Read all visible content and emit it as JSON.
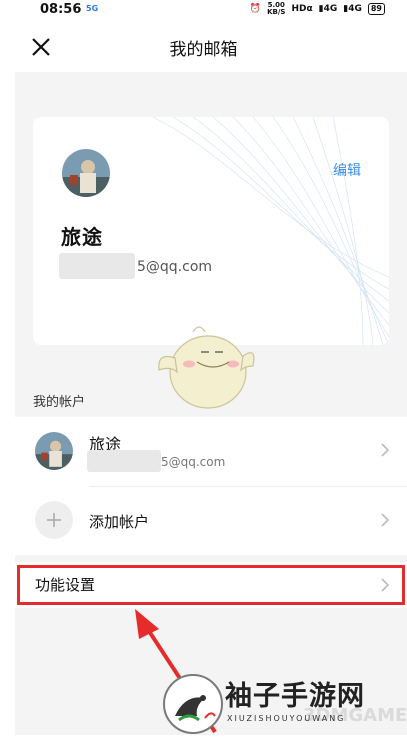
{
  "status_bar": {
    "time": "08:56",
    "network_badge": "5G",
    "speed_value": "5.00",
    "speed_unit": "KB/S",
    "hd_label": "HDα",
    "signal_1": "4G",
    "signal_2": "4G",
    "battery": "89"
  },
  "header": {
    "title": "我的邮箱",
    "close_icon": "close-icon"
  },
  "profile_card": {
    "name": "旅途",
    "email_visible_suffix": "5@qq.com",
    "edit_label": "编辑"
  },
  "accounts_section": {
    "label": "我的帐户",
    "accounts": [
      {
        "name": "旅途",
        "email_visible_suffix": "5@qq.com"
      }
    ],
    "add_account_label": "添加帐户"
  },
  "settings": {
    "label": "功能设置"
  },
  "watermark": {
    "title": "袖子手游网",
    "subtitle": "XIUZISHOUYOUWANG",
    "overlay": "3DMGAME"
  },
  "colors": {
    "accent_blue": "#3a8ee6",
    "highlight_red": "#e52b2b",
    "page_gray": "#f4f4f4"
  }
}
